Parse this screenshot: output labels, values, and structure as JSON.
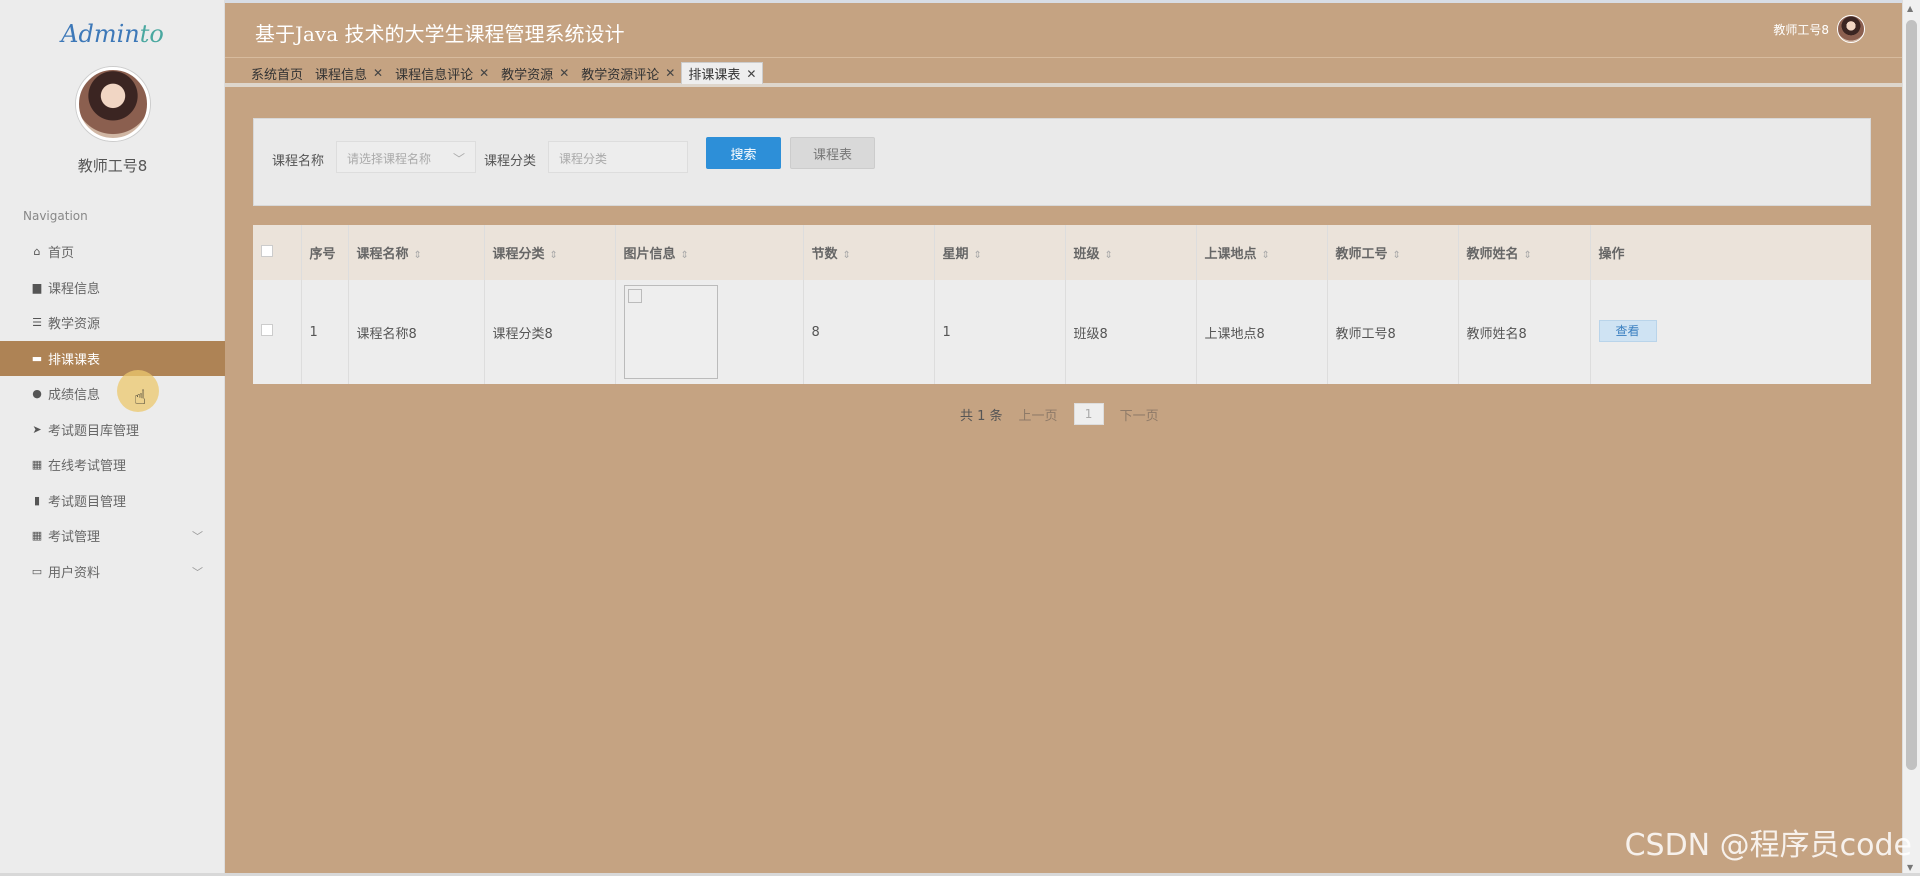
{
  "app": {
    "title": "基于Java 技术的大学生课程管理系统设计",
    "user": "教师工号8",
    "brand_a": "Admin",
    "brand_b": "to"
  },
  "sidebar": {
    "username": "教师工号8",
    "nav_caption": "Navigation",
    "items": [
      {
        "label": "首页",
        "icon": "home-icon"
      },
      {
        "label": "课程信息",
        "icon": "lock-icon"
      },
      {
        "label": "教学资源",
        "icon": "sliders-icon"
      },
      {
        "label": "排课课表",
        "icon": "ticket-icon"
      },
      {
        "label": "成绩信息",
        "icon": "lightbulb-icon"
      },
      {
        "label": "考试题目库管理",
        "icon": "send-icon"
      },
      {
        "label": "在线考试管理",
        "icon": "grid-icon"
      },
      {
        "label": "考试题目管理",
        "icon": "bar-chart-icon"
      },
      {
        "label": "考试管理",
        "icon": "grid-icon"
      },
      {
        "label": "用户资料",
        "icon": "id-card-icon"
      }
    ]
  },
  "tabs": [
    {
      "label": "系统首页",
      "closable": false
    },
    {
      "label": "课程信息",
      "closable": true
    },
    {
      "label": "课程信息评论",
      "closable": true
    },
    {
      "label": "教学资源",
      "closable": true
    },
    {
      "label": "教学资源评论",
      "closable": true
    },
    {
      "label": "排课课表",
      "closable": true,
      "active": true
    }
  ],
  "search": {
    "course_name_label": "课程名称",
    "course_name_placeholder": "请选择课程名称",
    "category_label": "课程分类",
    "category_placeholder": "课程分类",
    "search_button": "搜索",
    "schedule_button": "课程表"
  },
  "table": {
    "headers": [
      "序号",
      "课程名称",
      "课程分类",
      "图片信息",
      "节数",
      "星期",
      "班级",
      "上课地点",
      "教师工号",
      "教师姓名",
      "操作"
    ],
    "rows": [
      {
        "index": "1",
        "course_name": "课程名称8",
        "category": "课程分类8",
        "sessions": "8",
        "weekday": "1",
        "class": "班级8",
        "location": "上课地点8",
        "teacher_id": "教师工号8",
        "teacher_name": "教师姓名8",
        "action": "查看"
      }
    ]
  },
  "pagination": {
    "total": "共 1 条",
    "prev": "上一页",
    "page": "1",
    "next": "下一页"
  },
  "watermark": "CSDN @程序员code",
  "colors": {
    "background": "#c5a382",
    "active_nav": "#ae8355",
    "primary_button": "#2d8fd8"
  }
}
